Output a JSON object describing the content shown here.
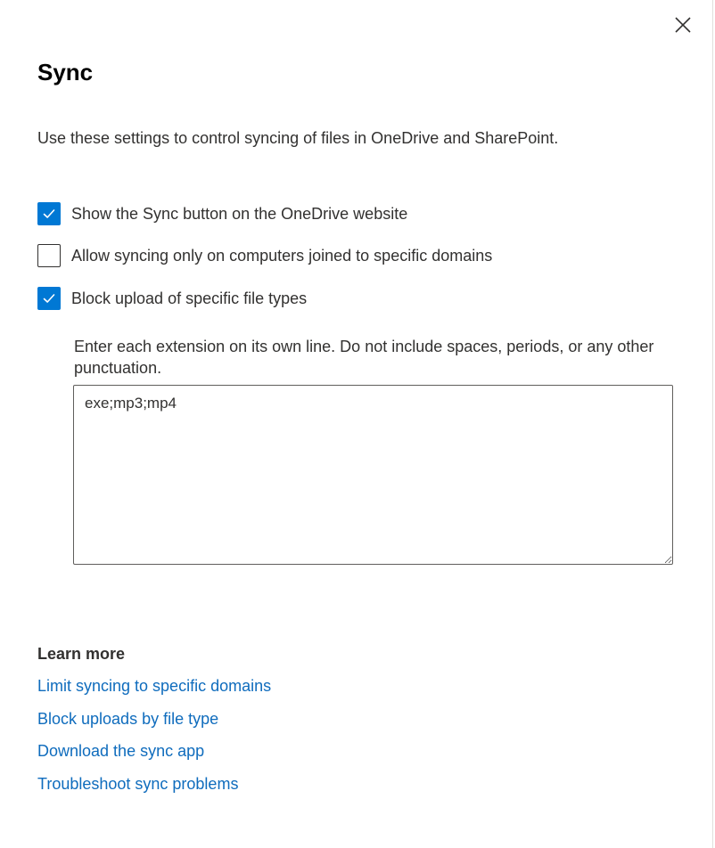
{
  "panel": {
    "title": "Sync",
    "description": "Use these settings to control syncing of files in OneDrive and SharePoint."
  },
  "close_button": {
    "icon": "close-icon"
  },
  "settings": [
    {
      "label": "Show the Sync button on the OneDrive website",
      "checked": true
    },
    {
      "label": "Allow syncing only on computers joined to specific domains",
      "checked": false
    },
    {
      "label": "Block upload of specific file types",
      "checked": true
    }
  ],
  "file_types": {
    "instructions": "Enter each extension on its own line. Do not include spaces, periods, or any other punctuation.",
    "value": "exe;mp3;mp4"
  },
  "learn_more": {
    "heading": "Learn more",
    "links": [
      "Limit syncing to specific domains",
      "Block uploads by file type",
      "Download the sync app",
      "Troubleshoot sync problems"
    ]
  },
  "colors": {
    "accent": "#0078d4",
    "link": "#0f6cbd",
    "text": "#323130"
  }
}
